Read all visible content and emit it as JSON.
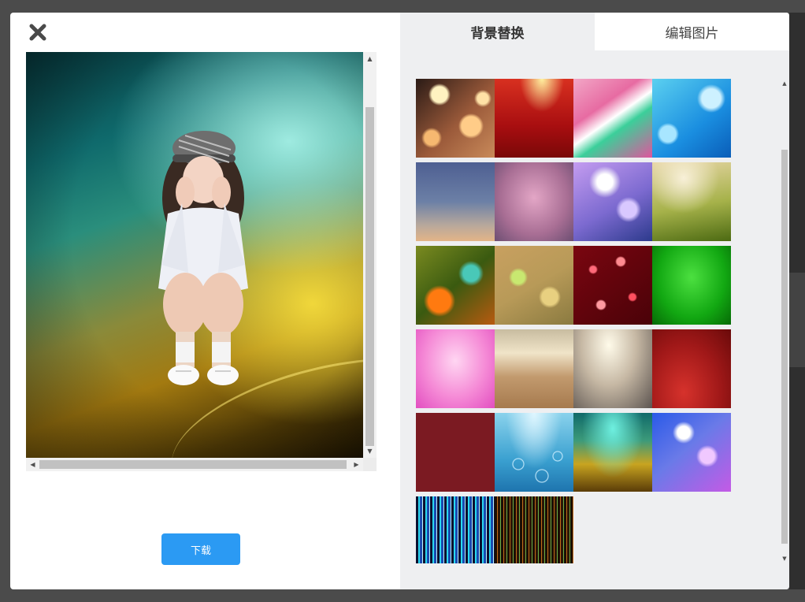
{
  "dialog": {
    "close_icon": "close-x-icon",
    "download_label": "下载"
  },
  "preview": {
    "background": "teal-to-gold gradient",
    "subject": "cut-out person portrait"
  },
  "tabs": [
    {
      "label": "背景替换",
      "active": true
    },
    {
      "label": "编辑图片",
      "active": false
    }
  ],
  "backgrounds": [
    {
      "name": "bokeh-orange"
    },
    {
      "name": "red-stage-light"
    },
    {
      "name": "pink-green-swirl"
    },
    {
      "name": "blue-bokeh"
    },
    {
      "name": "dusk-gradient"
    },
    {
      "name": "pink-blur"
    },
    {
      "name": "purple-bokeh"
    },
    {
      "name": "olive-bokeh"
    },
    {
      "name": "autumn-bokeh"
    },
    {
      "name": "gold-green-bokeh"
    },
    {
      "name": "red-sparkle"
    },
    {
      "name": "green-glow"
    },
    {
      "name": "magenta-fade"
    },
    {
      "name": "beige-blur"
    },
    {
      "name": "grey-blur"
    },
    {
      "name": "red-gradient"
    },
    {
      "name": "maroon-solid"
    },
    {
      "name": "underwater-bubbles"
    },
    {
      "name": "teal-gold"
    },
    {
      "name": "blue-purple-bokeh"
    },
    {
      "name": "blue-light-streaks"
    },
    {
      "name": "brown-stripes"
    }
  ],
  "colors": {
    "accent": "#2b9af3",
    "panel": "#eeeff1",
    "overlay": "#4b4b4b"
  }
}
